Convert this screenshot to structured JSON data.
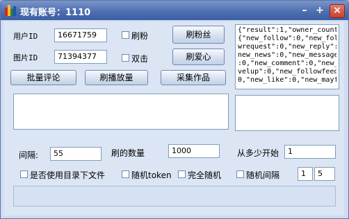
{
  "window": {
    "title": "现有账号：1110",
    "controls": {
      "minimize": "–",
      "maximize": "+",
      "close": "×"
    }
  },
  "form": {
    "user_id_label": "用户ID",
    "user_id_value": "16671759",
    "pic_id_label": "图片ID",
    "pic_id_value": "71394377",
    "check_fans_label": "刷粉",
    "check_double_label": "双击",
    "btn_fans": "刷粉丝",
    "btn_love": "刷爱心",
    "btn_batch_comment": "批量评论",
    "btn_play_count": "刷播放量",
    "btn_collect": "采集作品"
  },
  "response_panel": {
    "lines": [
      "{\"result\":1,\"owner_count\":",
      "{\"new_follow\":0,\"new_follo",
      "wrequest\":0,\"new_reply\":0,\"",
      "new_news\":0,\"new_message",
      ":0,\"new_comment\":0,\"new_le",
      "velup\":0,\"new_followfeed\":",
      "0,\"new_like\":0,\"new_mayfri"
    ]
  },
  "settings": {
    "interval_label": "间隔:",
    "interval_value": "55",
    "count_label": "刷的数量",
    "count_value": "1000",
    "start_label": "从多少开始",
    "start_value": "1",
    "use_dir_label": "是否使用目录下文件",
    "random_token_label": "随机token",
    "full_random_label": "完全随机",
    "random_interval_label": "随机间隔",
    "random_min": "1",
    "random_max": "5"
  },
  "colors": {
    "titlebar": "#4e6fb0",
    "client_bg": "#dbe5f4",
    "close_button": "#c9422c"
  }
}
